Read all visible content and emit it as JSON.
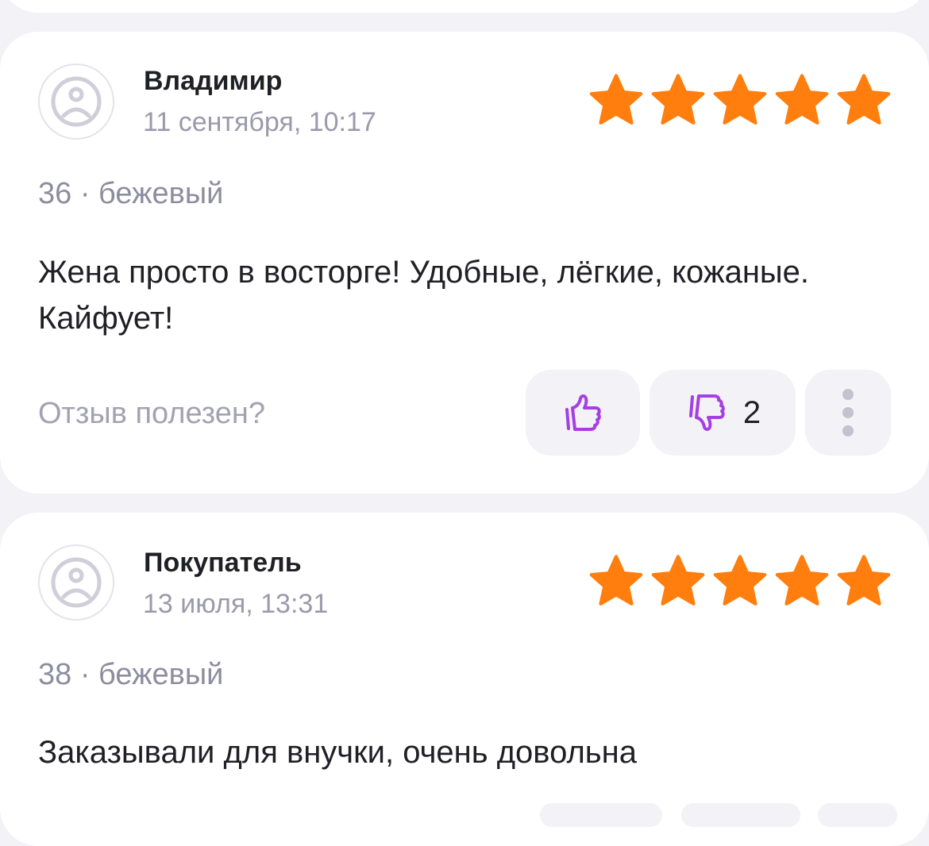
{
  "colors": {
    "star": "#ff7e0d",
    "vote_icon": "#a53fe3",
    "background": "#f2f2f7",
    "card": "#ffffff"
  },
  "reviews": [
    {
      "author": "Владимир",
      "date": "11 сентября, 10:17",
      "rating": 5,
      "variant": "36 · бежевый",
      "text": "Жена просто в восторге! Удобные, лёгкие, кожаные. Кайфует!",
      "useful_prompt": "Отзыв полезен?",
      "dislike_count": "2",
      "avatar_icon": "sad-face-icon"
    },
    {
      "author": "Покупатель",
      "date": "13 июля, 13:31",
      "rating": 5,
      "variant": "38 · бежевый",
      "text": "Заказывали для внучки, очень довольна",
      "avatar_icon": "sad-face-icon"
    }
  ]
}
